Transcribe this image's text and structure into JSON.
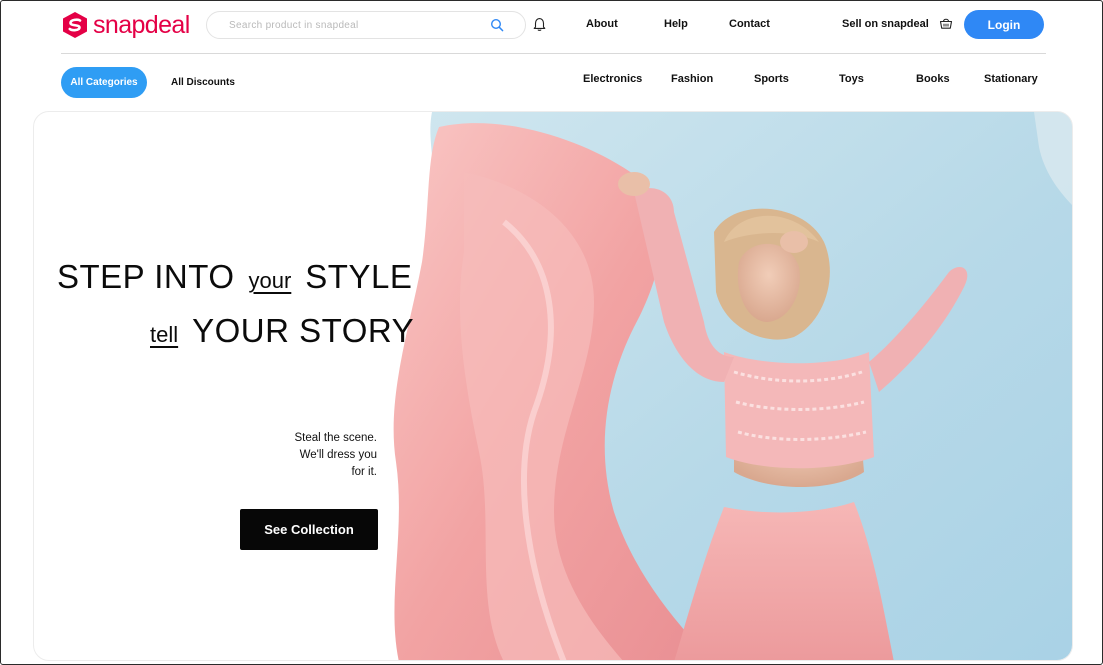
{
  "header": {
    "logo_text": "snapdeal",
    "search_placeholder": "Search product in snapdeal",
    "nav": [
      "About",
      "Help",
      "Contact"
    ],
    "sell_label": "Sell on snapdeal",
    "login_label": "Login"
  },
  "categories": {
    "all_label": "All Categories",
    "discounts_label": "All Discounts",
    "items": [
      "Electronics",
      "Fashion",
      "Sports",
      "Toys",
      "Books",
      "Stationary"
    ]
  },
  "hero": {
    "line1_a": "STEP INTO",
    "line1_script": "your",
    "line1_b": "STYLE",
    "line2_script": "tell",
    "line2_b": "YOUR STORY",
    "tagline_1": "Steal the scene.",
    "tagline_2": "We'll dress you",
    "tagline_3": "for it.",
    "cta_label": "See Collection"
  },
  "colors": {
    "brand": "#e40046",
    "login": "#2f88f5",
    "category_active": "#2f9df4",
    "cta": "#070707",
    "sky": "#b9dbe8",
    "dress": "#f2a9a9"
  },
  "icons": [
    "snapdeal-logo-icon",
    "search-icon",
    "bell-icon",
    "basket-icon"
  ]
}
